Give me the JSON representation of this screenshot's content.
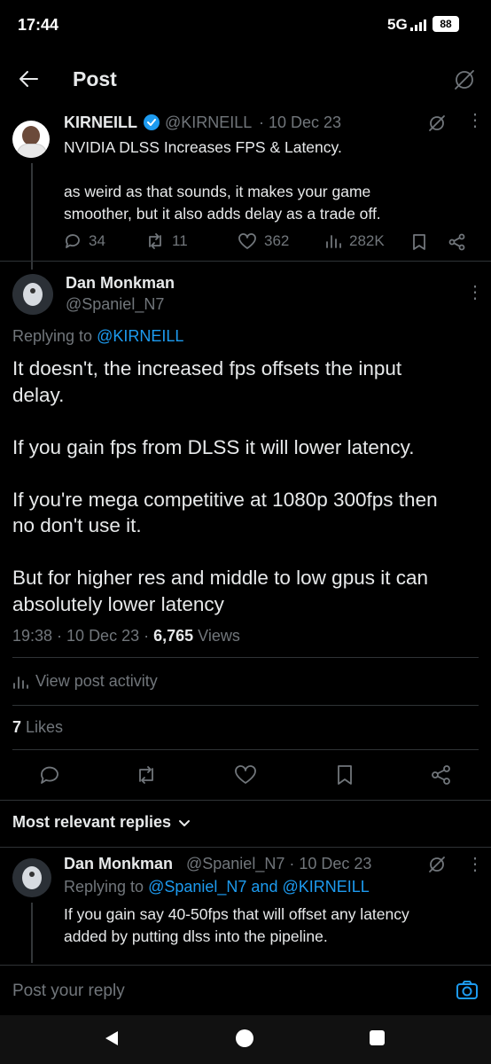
{
  "status_bar": {
    "time": "17:44",
    "network": "5G",
    "battery": "88"
  },
  "header": {
    "title": "Post"
  },
  "parent_post": {
    "name": "KIRNEILL",
    "handle": "@KIRNEILL",
    "date": "· 10 Dec 23",
    "line1": "NVIDIA DLSS Increases FPS & Latency.",
    "line2": "as weird as that sounds, it makes your game\nsmoother, but it also adds delay as a trade off.",
    "replies": "34",
    "reposts": "11",
    "likes": "362",
    "views": "282K"
  },
  "main_post": {
    "name": "Dan Monkman",
    "handle": "@Spaniel_N7",
    "replying_prefix": "Replying to",
    "replying_to": "@KIRNEILL",
    "text": "It doesn't, the increased fps offsets the input\ndelay.\n\nIf you gain fps from DLSS it will lower latency.\n\nIf you're mega competitive at 1080p 300fps then\nno don't use it.\n\nBut for higher res and middle to low gpus it can\nabsolutely lower latency",
    "time": "19:38 · 10 Dec 23 ·",
    "views_count": "6,765",
    "views_label": "Views",
    "activity": "View post activity",
    "likes_count": "7",
    "likes_label": "Likes"
  },
  "replies_section": {
    "sort_label": "Most relevant replies"
  },
  "reply": {
    "name": "Dan Monkman",
    "handle_date": "@Spaniel_N7 · 10 Dec 23",
    "replying_prefix": "Replying to",
    "replying_to": "@Spaniel_N7 and @KIRNEILL",
    "text": "If you gain say 40-50fps that will offset any latency\nadded by putting dlss into the pipeline."
  },
  "composer": {
    "placeholder": "Post your reply"
  },
  "colors": {
    "accent": "#1d9bf0",
    "background": "#000000",
    "text": "#e7e9ea",
    "muted": "#71767b",
    "divider": "#2f3336"
  }
}
